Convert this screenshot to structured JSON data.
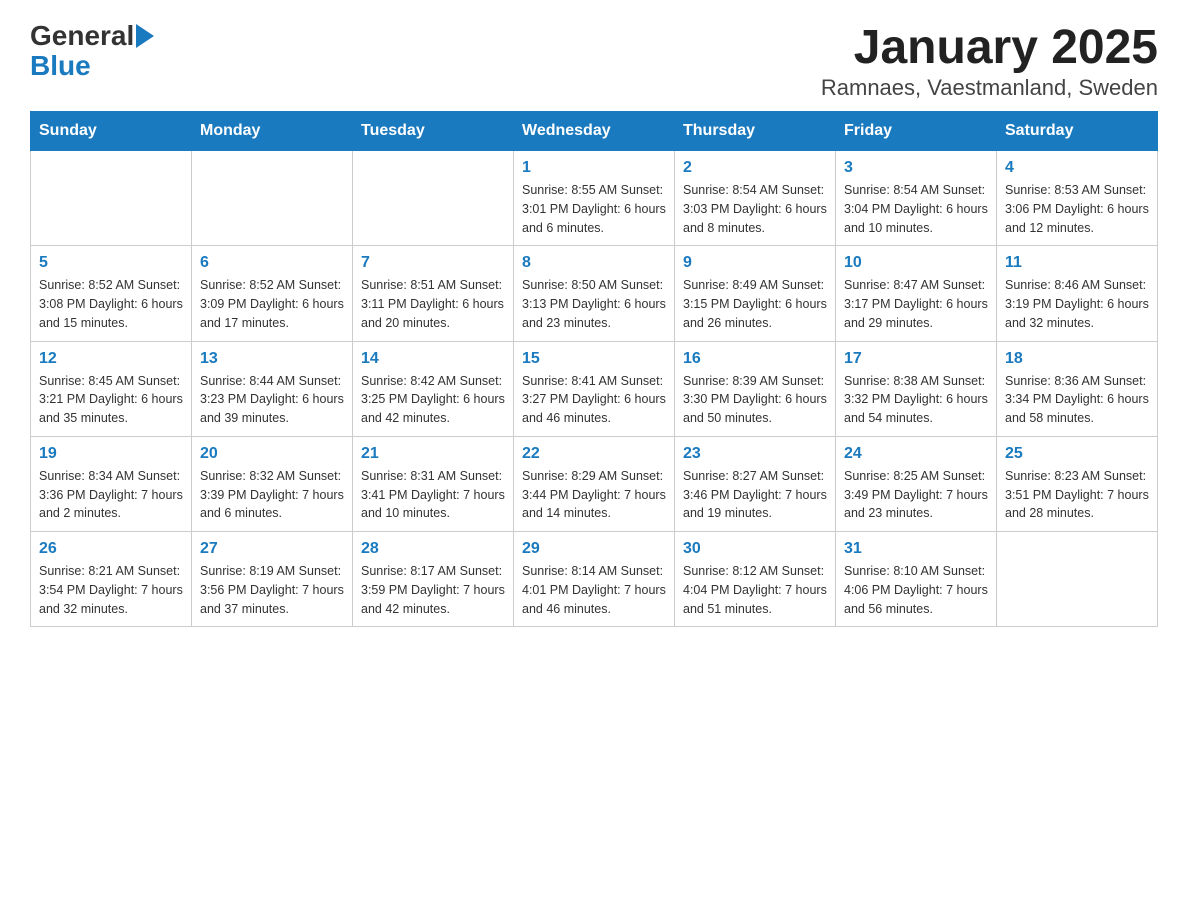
{
  "header": {
    "logo_general": "General",
    "logo_blue": "Blue",
    "title": "January 2025",
    "subtitle": "Ramnaes, Vaestmanland, Sweden"
  },
  "calendar": {
    "days_of_week": [
      "Sunday",
      "Monday",
      "Tuesday",
      "Wednesday",
      "Thursday",
      "Friday",
      "Saturday"
    ],
    "weeks": [
      [
        {
          "day": "",
          "info": ""
        },
        {
          "day": "",
          "info": ""
        },
        {
          "day": "",
          "info": ""
        },
        {
          "day": "1",
          "info": "Sunrise: 8:55 AM\nSunset: 3:01 PM\nDaylight: 6 hours and 6 minutes."
        },
        {
          "day": "2",
          "info": "Sunrise: 8:54 AM\nSunset: 3:03 PM\nDaylight: 6 hours and 8 minutes."
        },
        {
          "day": "3",
          "info": "Sunrise: 8:54 AM\nSunset: 3:04 PM\nDaylight: 6 hours and 10 minutes."
        },
        {
          "day": "4",
          "info": "Sunrise: 8:53 AM\nSunset: 3:06 PM\nDaylight: 6 hours and 12 minutes."
        }
      ],
      [
        {
          "day": "5",
          "info": "Sunrise: 8:52 AM\nSunset: 3:08 PM\nDaylight: 6 hours and 15 minutes."
        },
        {
          "day": "6",
          "info": "Sunrise: 8:52 AM\nSunset: 3:09 PM\nDaylight: 6 hours and 17 minutes."
        },
        {
          "day": "7",
          "info": "Sunrise: 8:51 AM\nSunset: 3:11 PM\nDaylight: 6 hours and 20 minutes."
        },
        {
          "day": "8",
          "info": "Sunrise: 8:50 AM\nSunset: 3:13 PM\nDaylight: 6 hours and 23 minutes."
        },
        {
          "day": "9",
          "info": "Sunrise: 8:49 AM\nSunset: 3:15 PM\nDaylight: 6 hours and 26 minutes."
        },
        {
          "day": "10",
          "info": "Sunrise: 8:47 AM\nSunset: 3:17 PM\nDaylight: 6 hours and 29 minutes."
        },
        {
          "day": "11",
          "info": "Sunrise: 8:46 AM\nSunset: 3:19 PM\nDaylight: 6 hours and 32 minutes."
        }
      ],
      [
        {
          "day": "12",
          "info": "Sunrise: 8:45 AM\nSunset: 3:21 PM\nDaylight: 6 hours and 35 minutes."
        },
        {
          "day": "13",
          "info": "Sunrise: 8:44 AM\nSunset: 3:23 PM\nDaylight: 6 hours and 39 minutes."
        },
        {
          "day": "14",
          "info": "Sunrise: 8:42 AM\nSunset: 3:25 PM\nDaylight: 6 hours and 42 minutes."
        },
        {
          "day": "15",
          "info": "Sunrise: 8:41 AM\nSunset: 3:27 PM\nDaylight: 6 hours and 46 minutes."
        },
        {
          "day": "16",
          "info": "Sunrise: 8:39 AM\nSunset: 3:30 PM\nDaylight: 6 hours and 50 minutes."
        },
        {
          "day": "17",
          "info": "Sunrise: 8:38 AM\nSunset: 3:32 PM\nDaylight: 6 hours and 54 minutes."
        },
        {
          "day": "18",
          "info": "Sunrise: 8:36 AM\nSunset: 3:34 PM\nDaylight: 6 hours and 58 minutes."
        }
      ],
      [
        {
          "day": "19",
          "info": "Sunrise: 8:34 AM\nSunset: 3:36 PM\nDaylight: 7 hours and 2 minutes."
        },
        {
          "day": "20",
          "info": "Sunrise: 8:32 AM\nSunset: 3:39 PM\nDaylight: 7 hours and 6 minutes."
        },
        {
          "day": "21",
          "info": "Sunrise: 8:31 AM\nSunset: 3:41 PM\nDaylight: 7 hours and 10 minutes."
        },
        {
          "day": "22",
          "info": "Sunrise: 8:29 AM\nSunset: 3:44 PM\nDaylight: 7 hours and 14 minutes."
        },
        {
          "day": "23",
          "info": "Sunrise: 8:27 AM\nSunset: 3:46 PM\nDaylight: 7 hours and 19 minutes."
        },
        {
          "day": "24",
          "info": "Sunrise: 8:25 AM\nSunset: 3:49 PM\nDaylight: 7 hours and 23 minutes."
        },
        {
          "day": "25",
          "info": "Sunrise: 8:23 AM\nSunset: 3:51 PM\nDaylight: 7 hours and 28 minutes."
        }
      ],
      [
        {
          "day": "26",
          "info": "Sunrise: 8:21 AM\nSunset: 3:54 PM\nDaylight: 7 hours and 32 minutes."
        },
        {
          "day": "27",
          "info": "Sunrise: 8:19 AM\nSunset: 3:56 PM\nDaylight: 7 hours and 37 minutes."
        },
        {
          "day": "28",
          "info": "Sunrise: 8:17 AM\nSunset: 3:59 PM\nDaylight: 7 hours and 42 minutes."
        },
        {
          "day": "29",
          "info": "Sunrise: 8:14 AM\nSunset: 4:01 PM\nDaylight: 7 hours and 46 minutes."
        },
        {
          "day": "30",
          "info": "Sunrise: 8:12 AM\nSunset: 4:04 PM\nDaylight: 7 hours and 51 minutes."
        },
        {
          "day": "31",
          "info": "Sunrise: 8:10 AM\nSunset: 4:06 PM\nDaylight: 7 hours and 56 minutes."
        },
        {
          "day": "",
          "info": ""
        }
      ]
    ]
  }
}
